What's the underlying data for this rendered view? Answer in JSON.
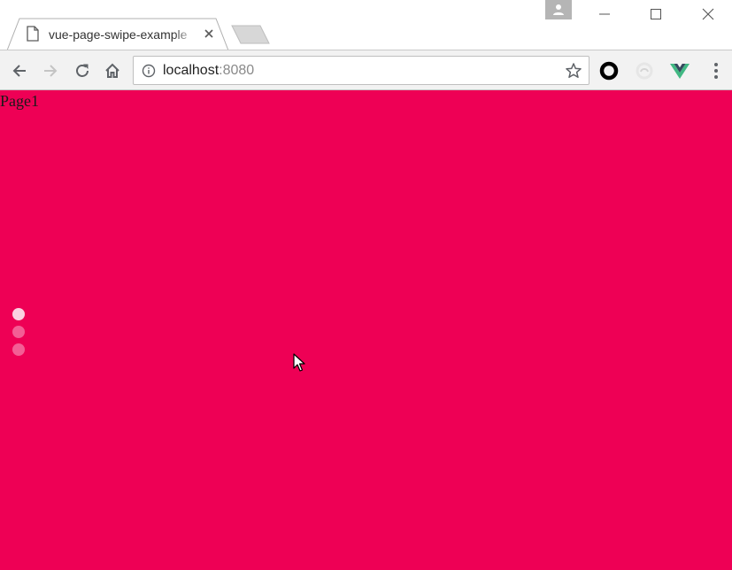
{
  "browser": {
    "tab": {
      "title": "vue-page-swipe-example",
      "favicon": "page-icon",
      "close_icon": "close-icon"
    },
    "new_tab_icon": "new-tab-icon",
    "profile_icon": "person-icon",
    "window_controls": [
      "minimize-icon",
      "maximize-icon",
      "close-icon"
    ],
    "toolbar": {
      "back_icon": "arrow-left-icon",
      "forward_icon": "arrow-right-icon",
      "reload_icon": "reload-icon",
      "home_icon": "home-icon",
      "address": {
        "info_icon": "info-icon",
        "host": "localhost",
        "port": ":8080",
        "bookmark_icon": "star-icon"
      },
      "extensions": [
        "ring-extension-icon",
        "ghost-extension-icon",
        "vue-devtools-icon"
      ],
      "menu_icon": "more-vertical-icon"
    }
  },
  "page": {
    "background": "#ee0055",
    "label": "Page1",
    "pagination": {
      "count": 3,
      "active_index": 0,
      "active_color": "#fbd1e1",
      "inactive_color": "#f35e95"
    }
  }
}
